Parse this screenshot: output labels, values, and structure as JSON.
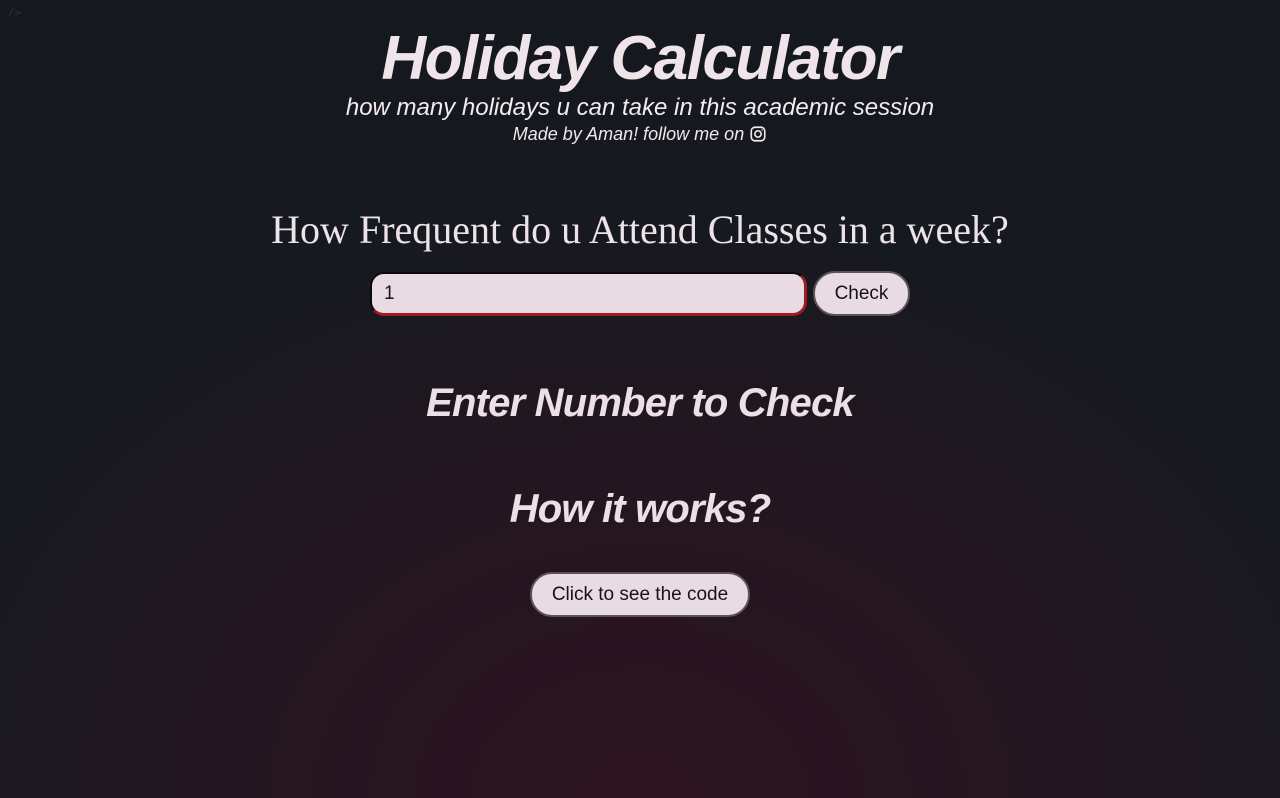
{
  "header": {
    "title": "Holiday Calculator",
    "subtitle": "how many holidays u can take in this academic session",
    "credit_text": "Made by Aman! follow me on",
    "credit_icon": "instagram-icon"
  },
  "form": {
    "question": "How Frequent do u Attend Classes in a week?",
    "input_value": "1",
    "check_label": "Check"
  },
  "result": {
    "text": "Enter Number to Check"
  },
  "how_it_works": {
    "heading": "How it works?",
    "code_button_label": "Click to see the code"
  },
  "colors": {
    "background_top": "#15181e",
    "background_bottom": "#2c1320",
    "text": "#eadde4",
    "input_background": "#e8dbe2",
    "input_focus_border": "#9e1b24"
  }
}
